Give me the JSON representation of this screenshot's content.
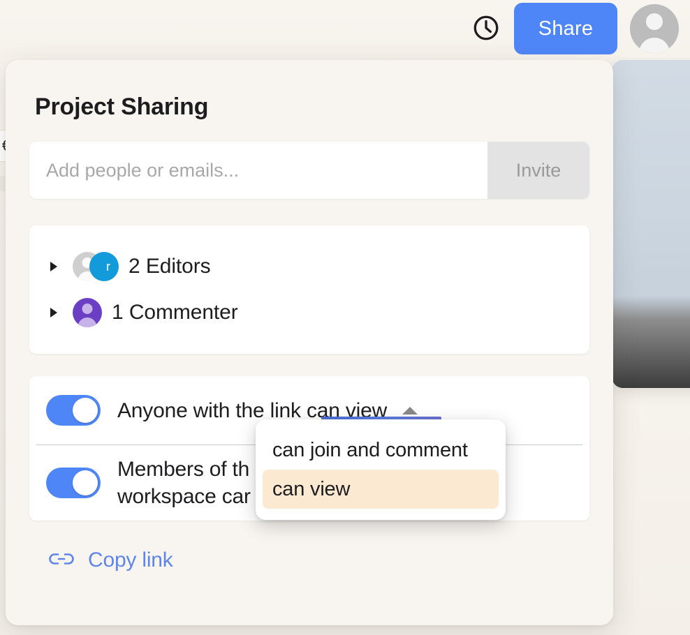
{
  "topbar": {
    "history_icon": "clock-history-icon",
    "share_label": "Share",
    "avatar_icon": "user-avatar-icon"
  },
  "dialog": {
    "title": "Project Sharing",
    "invite": {
      "placeholder": "Add people or emails...",
      "value": "",
      "button_label": "Invite"
    },
    "people": [
      {
        "label": "2 Editors",
        "avatar_badge": "r",
        "avatar_kind": "stack-gray-blue"
      },
      {
        "label": "1 Commenter",
        "avatar_badge": "",
        "avatar_kind": "purple"
      }
    ],
    "link_settings": [
      {
        "label": "Anyone with the link can view",
        "toggle_on": true,
        "has_caret": true
      },
      {
        "label": "Members of the\nworkspace can",
        "toggle_on": true,
        "has_caret": false
      }
    ],
    "link_row_2_line1": "Members of th",
    "link_row_2_line2": "workspace car",
    "dropdown": {
      "options": [
        {
          "label": "can join and comment",
          "selected": false
        },
        {
          "label": "can view",
          "selected": true
        }
      ]
    },
    "copy_link": {
      "label": "Copy link",
      "icon": "link-chain-icon"
    }
  },
  "colors": {
    "accent_blue": "#4f86f7",
    "link_blue": "#5d86e8",
    "highlight_cream": "#fbe9d2",
    "dialog_bg": "#f8f5f0",
    "page_bg": "#f6f2ec",
    "avatar_blue": "#129ada",
    "avatar_purple": "#6b3fc4",
    "select_underline": "#5b7ee0"
  }
}
